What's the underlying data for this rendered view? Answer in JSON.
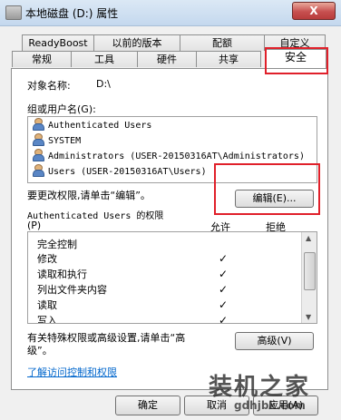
{
  "window": {
    "title": "本地磁盘 (D:) 属性",
    "close_label": "X"
  },
  "tabs_row1": [
    "ReadyBoost",
    "以前的版本",
    "配额",
    "自定义"
  ],
  "tabs_row2": [
    "常规",
    "工具",
    "硬件",
    "共享",
    "安全"
  ],
  "security": {
    "object_label": "对象名称:",
    "object_value": "D:\\",
    "group_label": "组或用户名(G):",
    "groups": [
      "Authenticated Users",
      "SYSTEM",
      "Administrators (USER-20150316AT\\Administrators)",
      "Users (USER-20150316AT\\Users)"
    ],
    "edit_prompt": "要更改权限,请单击“编辑”。",
    "edit_button": "编辑(E)...",
    "perm_label_1": "Authenticated Users 的权限",
    "perm_label_2": "(P)",
    "allow_header": "允许",
    "deny_header": "拒绝",
    "permissions": [
      {
        "name": "完全控制",
        "allow": ""
      },
      {
        "name": "修改",
        "allow": "✓"
      },
      {
        "name": "读取和执行",
        "allow": "✓"
      },
      {
        "name": "列出文件夹内容",
        "allow": "✓"
      },
      {
        "name": "读取",
        "allow": "✓"
      },
      {
        "name": "写入",
        "allow": "✓"
      }
    ],
    "special_text_1": "有关特殊权限或高级设置,请单击“高",
    "special_text_2": "级”。",
    "advanced_button": "高级(V)",
    "learn_link": "了解访问控制和权限"
  },
  "footer": {
    "ok": "确定",
    "cancel": "取消",
    "apply": "应用(A)"
  },
  "watermark": {
    "text": "装机之家",
    "url": "gdhjbk.com"
  }
}
